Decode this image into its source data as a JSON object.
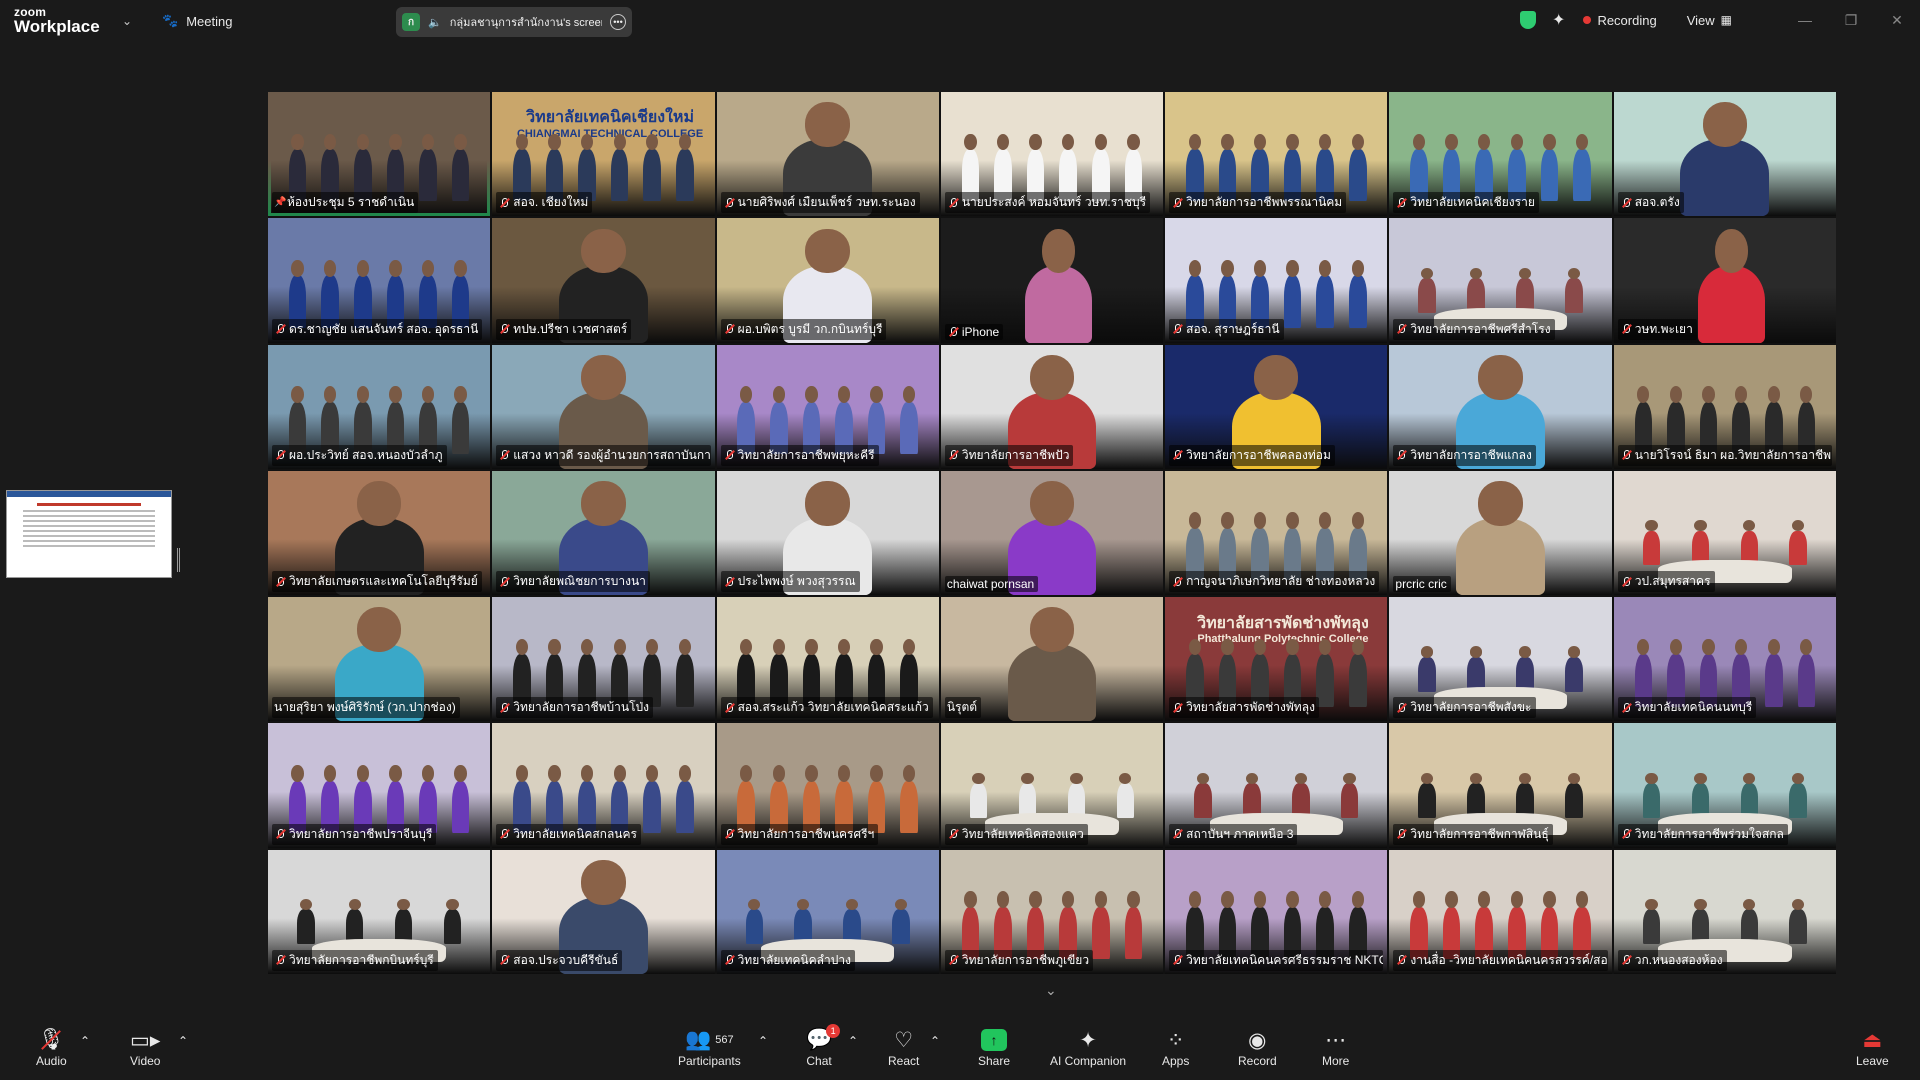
{
  "topbar": {
    "brand_top": "zoom",
    "brand_bottom": "Workplace",
    "meeting_label": "Meeting",
    "share_badge": "ก",
    "share_text": "กลุ่มลชานุการสำนักงาน's screen",
    "recording_label": "Recording",
    "view_label": "View"
  },
  "tiles": [
    {
      "label": "ห้องประชุม 5 ราชดำเนิน",
      "icon": "pin",
      "bg": "#6b5a4a",
      "kind": "group",
      "shirt": "#2a2a3a"
    },
    {
      "label": "สอจ. เชียงใหม่",
      "icon": "mic",
      "bg": "#c9a66b",
      "kind": "banner",
      "banner_text": "วิทยาลัยเทคนิคเชียงใหม่",
      "banner_sub": "CHIANGMAI TECHNICAL COLLEGE",
      "shirt": "#2b3a5a"
    },
    {
      "label": "นายศิริพงศ์ เมืยนเพ็ชร์ วษท.ระนอง",
      "icon": "mic",
      "bg": "#b9a98a",
      "kind": "single",
      "shirt": "#3b3b3b"
    },
    {
      "label": "นายประสงค์ หอมจันทร์ วษท.ราชบุรี",
      "icon": "mic",
      "bg": "#e8e0d0",
      "kind": "group",
      "shirt": "#f5f5f5"
    },
    {
      "label": "วิทยาลัยการอาชีพพรรณานิคม",
      "icon": "mic",
      "bg": "#d9c48a",
      "kind": "group",
      "shirt": "#2a4a8a"
    },
    {
      "label": "วิทยาลัยเทคนิคเชียงราย",
      "icon": "mic",
      "bg": "#8ab58a",
      "kind": "group",
      "shirt": "#3a6ab5"
    },
    {
      "label": "สอจ.ตรัง",
      "icon": "mic",
      "bg": "#bcd8d0",
      "kind": "single",
      "shirt": "#2a3a6a"
    },
    {
      "label": "ดร.ชาญชัย แสนจันทร์ สอจ. อุดรธานี",
      "icon": "mic",
      "bg": "#6a7aa8",
      "kind": "group",
      "shirt": "#1e3a8a"
    },
    {
      "label": "ทปษ.ปรีชา เวชศาสตร์",
      "icon": "mic",
      "bg": "#6b5840",
      "kind": "single",
      "shirt": "#222"
    },
    {
      "label": "ผอ.บพิตร บูรมี วก.กบินทร์บุรี",
      "icon": "mic",
      "bg": "#c8b88a",
      "kind": "single",
      "shirt": "#e8e8f0"
    },
    {
      "label": "iPhone",
      "icon": "mic",
      "bg": "#1c1c1c",
      "kind": "portrait",
      "shirt": "#c06aa0"
    },
    {
      "label": "สอจ. สุราษฎร์ธานี",
      "icon": "mic",
      "bg": "#d8d8e8",
      "kind": "group",
      "shirt": "#2a4a9a"
    },
    {
      "label": "วิทยาลัยการอาชีพศรีสำโรง",
      "icon": "mic",
      "bg": "#c8c8d8",
      "kind": "room",
      "shirt": "#8a4a4a"
    },
    {
      "label": "วษท.พะเยา",
      "icon": "mic",
      "bg": "#2a2a2a",
      "kind": "portrait",
      "shirt": "#d82a3a"
    },
    {
      "label": "ผอ.ประวิทย์ สอจ.หนองบัวลำภู",
      "icon": "mic",
      "bg": "#7a9ab0",
      "kind": "group",
      "shirt": "#3a3a3a"
    },
    {
      "label": "แสวง หาวดี รองผู้อำนวยการสถาบันการศึกษา",
      "icon": "mic",
      "bg": "#8aa8b8",
      "kind": "single",
      "shirt": "#6a5a4a"
    },
    {
      "label": "วิทยาลัยการอาชีพพยุหะคีรี",
      "icon": "mic",
      "bg": "#a888c8",
      "kind": "group",
      "shirt": "#5a6ab8"
    },
    {
      "label": "วิทยาลัยการอาชีพปัว",
      "icon": "mic",
      "bg": "#e0e0e0",
      "kind": "single",
      "shirt": "#b83a3a"
    },
    {
      "label": "วิทยาลัยการอาชีพคลองท่อม",
      "icon": "mic",
      "bg": "#1a2a6a",
      "kind": "single",
      "shirt": "#f0c030"
    },
    {
      "label": "วิทยาลัยการอาชีพแกลง",
      "icon": "mic",
      "bg": "#b8c8d8",
      "kind": "single",
      "shirt": "#4aa8d8"
    },
    {
      "label": "นายวิโรจน์ ธิมา ผอ.วิทยาลัยการอาชีพ",
      "icon": "mic",
      "bg": "#a89878",
      "kind": "group",
      "shirt": "#2a2a2a"
    },
    {
      "label": "วิทยาลัยเกษตรและเทคโนโลยีบุรีรัมย์",
      "icon": "mic",
      "bg": "#a8785a",
      "kind": "single",
      "shirt": "#222"
    },
    {
      "label": "วิทยาลัยพณิชยการบางนา",
      "icon": "mic",
      "bg": "#8aa898",
      "kind": "single",
      "shirt": "#3a4a8a"
    },
    {
      "label": "ประไพพงษ์ พวงสุวรรณ",
      "icon": "mic",
      "bg": "#d8d8d8",
      "kind": "single",
      "shirt": "#e8e8e8"
    },
    {
      "label": "chaiwat pornsan",
      "icon": "none",
      "bg": "#a89890",
      "kind": "single",
      "shirt": "#8a3ac8"
    },
    {
      "label": "กาญจนาภิเษกวิทยาลัย ช่างทองหลวง",
      "icon": "mic",
      "bg": "#c8b898",
      "kind": "group",
      "shirt": "#6a7a8a"
    },
    {
      "label": "prcric cric",
      "icon": "none",
      "bg": "#d8d8d8",
      "kind": "single",
      "shirt": "#b8a080"
    },
    {
      "label": "วป.สมุทรสาคร",
      "icon": "mic",
      "bg": "#e0d8d0",
      "kind": "room",
      "shirt": "#c83a3a"
    },
    {
      "label": "นายสุริยา พงษ์ศิริรักษ์ (วก.ปากช่อง)",
      "icon": "none",
      "bg": "#b8a888",
      "kind": "single",
      "shirt": "#3aa8c8"
    },
    {
      "label": "วิทยาลัยการอาชีพบ้านโป่ง",
      "icon": "mic",
      "bg": "#b8b8c8",
      "kind": "group",
      "shirt": "#222"
    },
    {
      "label": "สอจ.สระแก้ว วิทยาลัยเทคนิคสระแก้ว",
      "icon": "mic",
      "bg": "#d8d0b8",
      "kind": "group",
      "shirt": "#1a1a1a"
    },
    {
      "label": "นิรุตต์",
      "icon": "none",
      "bg": "#c8b8a0",
      "kind": "single",
      "shirt": "#6a5a4a"
    },
    {
      "label": "วิทยาลัยสารพัดช่างพัทลุง",
      "icon": "mic",
      "bg": "#8a3a3a",
      "kind": "banner",
      "banner_text": "วิทยาลัยสารพัดช่างพัทลุง",
      "banner_sub": "Phatthalung Polytechnic College",
      "shirt": "#3a3a3a"
    },
    {
      "label": "วิทยาลัยการอาชีพสังขะ",
      "icon": "mic",
      "bg": "#d8d8e0",
      "kind": "room",
      "shirt": "#3a3a6a"
    },
    {
      "label": "วิทยาลัยเทคนิคนนทบุรี",
      "icon": "mic",
      "bg": "#9a88b8",
      "kind": "group",
      "shirt": "#5a3a8a"
    },
    {
      "label": "วิทยาลัยการอาชีพปราจีนบุรี",
      "icon": "mic",
      "bg": "#c8c0d8",
      "kind": "group",
      "shirt": "#6a3ab8"
    },
    {
      "label": "วิทยาลัยเทคนิคสกลนคร",
      "icon": "mic",
      "bg": "#d8d0c0",
      "kind": "group",
      "shirt": "#3a4a8a"
    },
    {
      "label": "วิทยาลัยการอาชีพนครศรีฯ",
      "icon": "mic",
      "bg": "#a89a88",
      "kind": "group",
      "shirt": "#c86a3a"
    },
    {
      "label": "วิทยาลัยเทคนิคสองแคว",
      "icon": "mic",
      "bg": "#d8d0b8",
      "kind": "room",
      "shirt": "#e8e8e8"
    },
    {
      "label": "สถาบันฯ ภาคเหนือ 3",
      "icon": "mic",
      "bg": "#d0d0d8",
      "kind": "room",
      "shirt": "#8a3a3a"
    },
    {
      "label": "วิทยาลัยการอาชีพกาฬสินธุ์",
      "icon": "mic",
      "bg": "#d8c8a8",
      "kind": "room",
      "shirt": "#222"
    },
    {
      "label": "วิทยาลัยการอาชีพร่วมใจสกล",
      "icon": "mic",
      "bg": "#a8c8c8",
      "kind": "room",
      "shirt": "#3a6a6a"
    },
    {
      "label": "วิทยาลัยการอาชีพกบินทร์บุรี",
      "icon": "mic",
      "bg": "#d8d8d8",
      "kind": "room",
      "shirt": "#222"
    },
    {
      "label": "สอจ.ประจวบคีรีขันธ์",
      "icon": "mic",
      "bg": "#e8e0d8",
      "kind": "single",
      "shirt": "#3a4a6a"
    },
    {
      "label": "วิทยาลัยเทคนิคลำปาง",
      "icon": "mic",
      "bg": "#7a8ab8",
      "kind": "room",
      "shirt": "#2a4a8a"
    },
    {
      "label": "วิทยาลัยการอาชีพภูเขียว",
      "icon": "mic",
      "bg": "#c8c0b0",
      "kind": "group",
      "shirt": "#b83a3a"
    },
    {
      "label": "วิทยาลัยเทคนิคนครศรีธรรมราช NKTC One",
      "icon": "mic",
      "bg": "#b8a0c8",
      "kind": "group",
      "shirt": "#222"
    },
    {
      "label": "งานสื่อ -วิทยาลัยเทคนิคนครสวรรค์/สอ...",
      "icon": "mic",
      "bg": "#d8d0c8",
      "kind": "group",
      "shirt": "#c83a3a"
    },
    {
      "label": "วก.หนองสองห้อง",
      "icon": "mic",
      "bg": "#d8d8d0",
      "kind": "room",
      "shirt": "#3a3a3a"
    }
  ],
  "toolbar": {
    "audio_label": "Audio",
    "video_label": "Video",
    "participants_label": "Participants",
    "participants_count": "567",
    "chat_label": "Chat",
    "chat_badge": "1",
    "react_label": "React",
    "share_label": "Share",
    "ai_label": "AI Companion",
    "apps_label": "Apps",
    "record_label": "Record",
    "more_label": "More",
    "leave_label": "Leave"
  }
}
